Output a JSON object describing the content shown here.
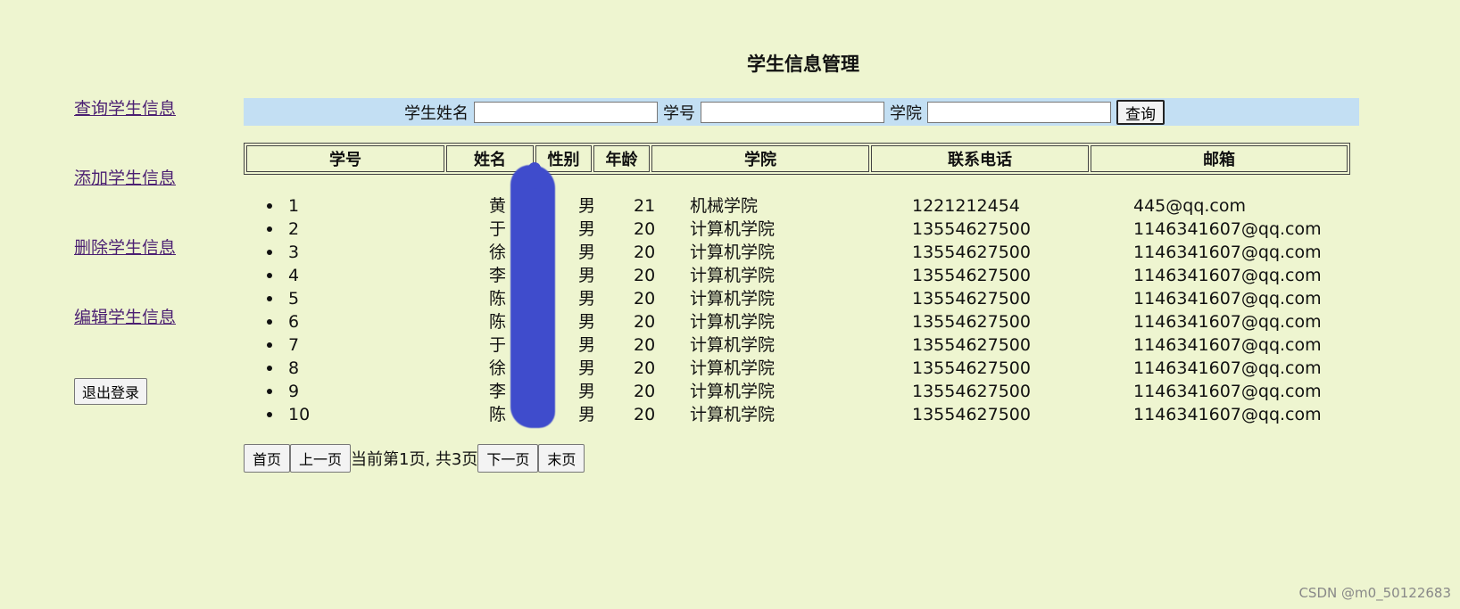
{
  "title": "学生信息管理",
  "sidebar": {
    "links": [
      {
        "label": "查询学生信息"
      },
      {
        "label": "添加学生信息"
      },
      {
        "label": "删除学生信息"
      },
      {
        "label": "编辑学生信息"
      }
    ],
    "logout": "退出登录"
  },
  "search": {
    "name_label": "学生姓名",
    "id_label": "学号",
    "college_label": "学院",
    "button": "查询"
  },
  "table": {
    "headers": [
      "学号",
      "姓名",
      "性别",
      "年龄",
      "学院",
      "联系电话",
      "邮箱"
    ],
    "rows": [
      {
        "id": "1",
        "name": "黄",
        "gender": "男",
        "age": "21",
        "college": "机械学院",
        "phone": "1221212454",
        "email": "445@qq.com"
      },
      {
        "id": "2",
        "name": "于",
        "gender": "男",
        "age": "20",
        "college": "计算机学院",
        "phone": "13554627500",
        "email": "1146341607@qq.com"
      },
      {
        "id": "3",
        "name": "徐",
        "gender": "男",
        "age": "20",
        "college": "计算机学院",
        "phone": "13554627500",
        "email": "1146341607@qq.com"
      },
      {
        "id": "4",
        "name": "李",
        "gender": "男",
        "age": "20",
        "college": "计算机学院",
        "phone": "13554627500",
        "email": "1146341607@qq.com"
      },
      {
        "id": "5",
        "name": "陈",
        "gender": "男",
        "age": "20",
        "college": "计算机学院",
        "phone": "13554627500",
        "email": "1146341607@qq.com"
      },
      {
        "id": "6",
        "name": "陈",
        "gender": "男",
        "age": "20",
        "college": "计算机学院",
        "phone": "13554627500",
        "email": "1146341607@qq.com"
      },
      {
        "id": "7",
        "name": "于",
        "gender": "男",
        "age": "20",
        "college": "计算机学院",
        "phone": "13554627500",
        "email": "1146341607@qq.com"
      },
      {
        "id": "8",
        "name": "徐",
        "gender": "男",
        "age": "20",
        "college": "计算机学院",
        "phone": "13554627500",
        "email": "1146341607@qq.com"
      },
      {
        "id": "9",
        "name": "李",
        "gender": "男",
        "age": "20",
        "college": "计算机学院",
        "phone": "13554627500",
        "email": "1146341607@qq.com"
      },
      {
        "id": "10",
        "name": "陈",
        "gender": "男",
        "age": "20",
        "college": "计算机学院",
        "phone": "13554627500",
        "email": "1146341607@qq.com"
      }
    ]
  },
  "pager": {
    "first": "首页",
    "prev": "上一页",
    "status": "当前第1页, 共3页",
    "next": "下一页",
    "last": "末页"
  },
  "watermark": "CSDN @m0_50122683",
  "colors": {
    "background": "#eef5d0",
    "search_bar": "#c3dff3",
    "link": "#4b1f72",
    "redaction": "#3f4ccc"
  }
}
